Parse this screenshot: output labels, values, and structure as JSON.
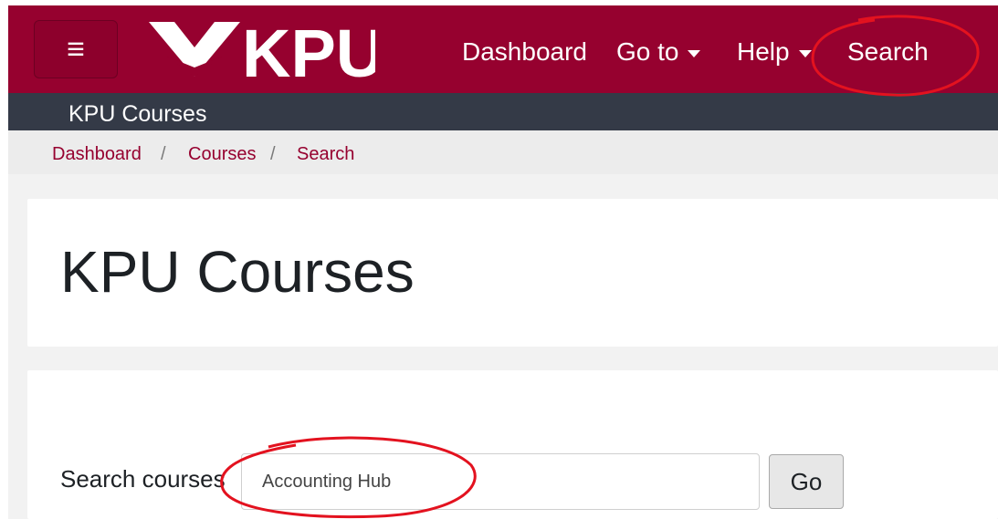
{
  "colors": {
    "brand": "#96012f",
    "subbar": "#343a47",
    "breadcrumb_bg": "#ececec",
    "annotation": "#e3121f"
  },
  "navbar": {
    "menu_icon": "hamburger-icon",
    "logo_text": "KPU",
    "logo_icon": "kpu-chevron-logo",
    "items": [
      {
        "label": "Dashboard"
      },
      {
        "label": "Go to",
        "has_dropdown": true
      },
      {
        "label": "Help",
        "has_dropdown": true
      },
      {
        "label": "Search"
      }
    ]
  },
  "subbar": {
    "title": "KPU Courses"
  },
  "breadcrumb": {
    "items": [
      "Dashboard",
      "Courses",
      "Search"
    ],
    "separator": "/"
  },
  "main": {
    "page_title": "KPU Courses",
    "search": {
      "label": "Search courses",
      "value": "Accounting Hub",
      "button_label": "Go"
    }
  }
}
